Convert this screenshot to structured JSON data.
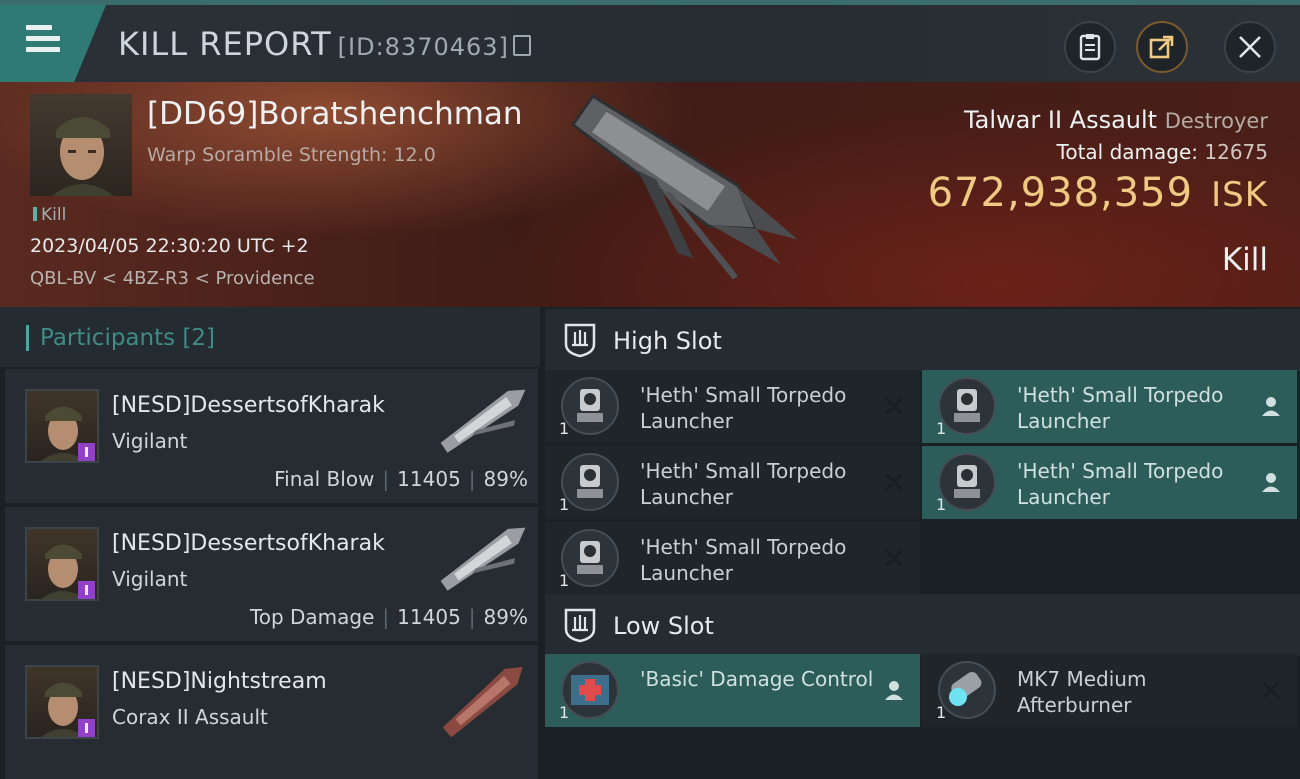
{
  "header": {
    "title": "KILL REPORT",
    "report_id": "[ID:8370463]",
    "icons": [
      "menu-icon",
      "clipboard-icon",
      "share-icon",
      "close-icon"
    ]
  },
  "victim": {
    "name": "[DD69]Boratshenchman",
    "warp_scramble": "Warp Soramble Strength: 12.0",
    "kill_label": "Kill",
    "datetime": "2023/04/05 22:30:20 UTC +2",
    "location": "QBL-BV < 4BZ-R3 < Providence",
    "ship_name": "Talwar II Assault",
    "ship_class": "Destroyer",
    "total_damage_label": "Total damage:",
    "total_damage": "12675",
    "isk_value": "672,938,359",
    "isk_unit": "ISK",
    "result": "Kill"
  },
  "participants": {
    "heading": "Participants [2]",
    "items": [
      {
        "name": "[NESD]DessertsofKharak",
        "ship": "Vigilant",
        "role": "Final Blow",
        "damage": "11405",
        "percent": "89%"
      },
      {
        "name": "[NESD]DessertsofKharak",
        "ship": "Vigilant",
        "role": "Top Damage",
        "damage": "11405",
        "percent": "89%"
      },
      {
        "name": "[NESD]Nightstream",
        "ship": "Corax II Assault",
        "role": "",
        "damage": "",
        "percent": ""
      }
    ]
  },
  "high_slot": {
    "heading": "High Slot",
    "items": [
      {
        "qty": "1",
        "name": "'Heth' Small Torpedo Launcher",
        "status": "destroyed"
      },
      {
        "qty": "1",
        "name": "'Heth' Small Torpedo Launcher",
        "status": "dropped"
      },
      {
        "qty": "1",
        "name": "'Heth' Small Torpedo Launcher",
        "status": "destroyed"
      },
      {
        "qty": "1",
        "name": "'Heth' Small Torpedo Launcher",
        "status": "dropped"
      },
      {
        "qty": "1",
        "name": "'Heth' Small Torpedo Launcher",
        "status": "destroyed"
      }
    ]
  },
  "low_slot": {
    "heading": "Low Slot",
    "items": [
      {
        "qty": "1",
        "name": "'Basic' Damage Control",
        "status": "dropped"
      },
      {
        "qty": "1",
        "name": "MK7 Medium Afterburner",
        "status": "destroyed"
      }
    ]
  },
  "colors": {
    "accent": "#2f7a75",
    "isk_gold": "#f0c983",
    "dropped_bg": "#2c5d5b",
    "destroyed_bg": "#1f2529"
  }
}
